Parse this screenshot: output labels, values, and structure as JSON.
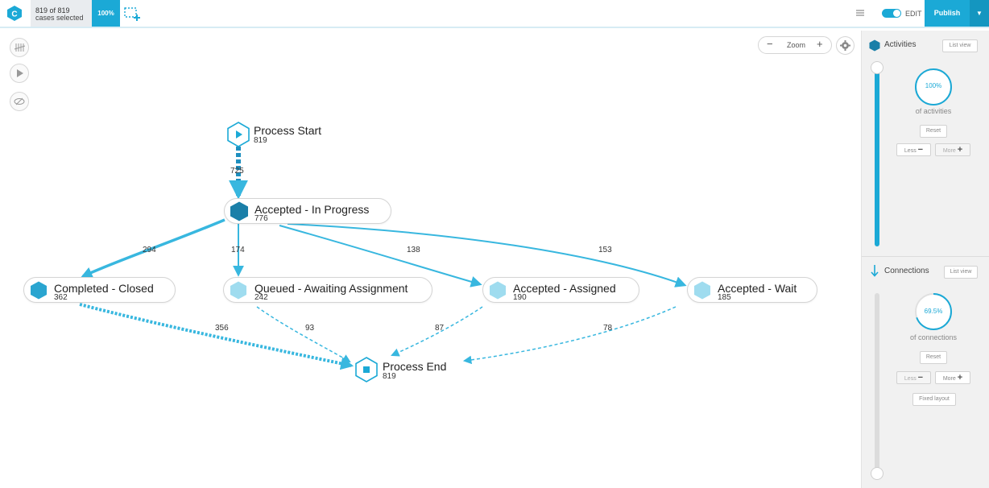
{
  "header": {
    "logo_letter": "C",
    "cases_line1": "819 of 819",
    "cases_line2": "cases selected",
    "percent": "100%",
    "edit_label": "EDIT",
    "publish_label": "Publish",
    "accent_color": "#1ba9d6"
  },
  "toolbar": {
    "zoom_label": "Zoom",
    "zoom_minus": "−",
    "zoom_plus": "+"
  },
  "graph": {
    "nodes": {
      "start": {
        "label": "Process Start",
        "count": "819"
      },
      "accepted_in_progress": {
        "label": "Accepted - In Progress",
        "count": "776"
      },
      "completed_closed": {
        "label": "Completed - Closed",
        "count": "362"
      },
      "queued": {
        "label": "Queued - Awaiting Assignment",
        "count": "242"
      },
      "accepted_assigned": {
        "label": "Accepted - Assigned",
        "count": "190"
      },
      "accepted_wait": {
        "label": "Accepted - Wait",
        "count": "185"
      },
      "end": {
        "label": "Process End",
        "count": "819"
      }
    },
    "edges": {
      "start_to_aip": "725",
      "aip_to_completed": "294",
      "aip_to_queued": "174",
      "aip_to_assigned": "138",
      "aip_to_wait": "153",
      "completed_to_end": "356",
      "queued_to_end": "93",
      "assigned_to_end": "87",
      "wait_to_end": "78"
    }
  },
  "panel": {
    "activities": {
      "title": "Activities",
      "list_view": "List view",
      "percent": "100%",
      "percent_value": 1.0,
      "caption": "of activities",
      "reset": "Reset",
      "less": "Less",
      "more": "More"
    },
    "connections": {
      "title": "Connections",
      "list_view": "List view",
      "percent": "69.5%",
      "percent_value": 0.695,
      "caption": "of connections",
      "reset": "Reset",
      "less": "Less",
      "more": "More",
      "fixed_layout": "Fixed layout"
    }
  }
}
